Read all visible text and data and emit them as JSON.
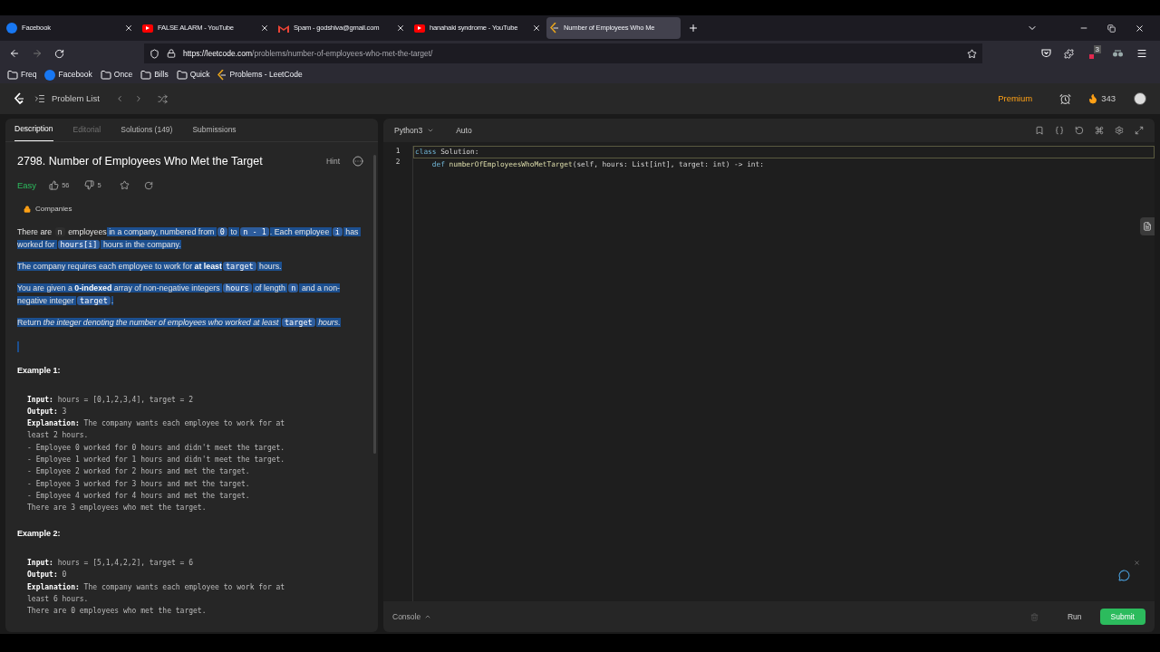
{
  "browser_tabs": [
    {
      "title": "Facebook",
      "kind": "facebook",
      "selected": false
    },
    {
      "title": "FALSE ALARM - YouTube",
      "kind": "youtube",
      "selected": false
    },
    {
      "title": "Spam - godshiva@gmail.com",
      "kind": "mail",
      "selected": false
    },
    {
      "title": "hanahaki syndrome - YouTube",
      "kind": "youtube",
      "selected": false
    },
    {
      "title": "Number of Employees Who Me",
      "kind": "leetcode",
      "selected": true
    }
  ],
  "address_bar": {
    "url_host": "https://leetcode.com",
    "url_path": "/problems/number-of-employees-who-met-the-target/"
  },
  "extension_badge": "3",
  "bookmarks": [
    {
      "label": "Freq",
      "kind": "folder"
    },
    {
      "label": "Facebook",
      "kind": "facebook"
    },
    {
      "label": "Once",
      "kind": "folder"
    },
    {
      "label": "Bills",
      "kind": "folder"
    },
    {
      "label": "Quick",
      "kind": "folder"
    },
    {
      "label": "Problems - LeetCode",
      "kind": "leetcode"
    }
  ],
  "site_header": {
    "problem_list": "Problem List",
    "premium": "Premium",
    "streak": "343"
  },
  "panel_tabs": [
    {
      "label": "Description",
      "selected": true,
      "disabled": false
    },
    {
      "label": "Editorial",
      "selected": false,
      "disabled": true
    },
    {
      "label": "Solutions (149)",
      "selected": false,
      "disabled": false
    },
    {
      "label": "Submissions",
      "selected": false,
      "disabled": false
    }
  ],
  "problem": {
    "title": "2798. Number of Employees Who Met the Target",
    "hint": "Hint",
    "difficulty": "Easy",
    "likes": "56",
    "dislikes": "5",
    "companies": "Companies",
    "paragraphs": [
      [
        {
          "text": "There are ",
          "kind": "text",
          "highlighted": false
        },
        {
          "text": "n",
          "kind": "code",
          "highlighted": false
        },
        {
          "text": " employees",
          "kind": "text",
          "highlighted": false
        },
        {
          "text": " in a company, numbered from ",
          "kind": "text",
          "highlighted": true
        },
        {
          "text": "0",
          "kind": "code",
          "highlighted": true
        },
        {
          "text": " to ",
          "kind": "text",
          "highlighted": true
        },
        {
          "text": "n - 1",
          "kind": "code",
          "highlighted": true
        },
        {
          "text": ". Each employee ",
          "kind": "text",
          "highlighted": true
        },
        {
          "text": "i",
          "kind": "code",
          "highlighted": true
        },
        {
          "text": " has worked for ",
          "kind": "text",
          "highlighted": true
        },
        {
          "text": "hours[i]",
          "kind": "code",
          "highlighted": true
        },
        {
          "text": " hours in the company.",
          "kind": "text",
          "highlighted": true
        }
      ],
      [
        {
          "text": "The company requires each employee to work for ",
          "kind": "text",
          "highlighted": true
        },
        {
          "text": "at least",
          "kind": "bold",
          "highlighted": true
        },
        {
          "text": "target",
          "kind": "code",
          "highlighted": true
        },
        {
          "text": " hours.",
          "kind": "text",
          "highlighted": true
        }
      ],
      [
        {
          "text": "You are given a ",
          "kind": "text",
          "highlighted": true
        },
        {
          "text": "0-indexed",
          "kind": "bold",
          "highlighted": true
        },
        {
          "text": " array of non-negative integers ",
          "kind": "text",
          "highlighted": true
        },
        {
          "text": "hours",
          "kind": "code",
          "highlighted": true
        },
        {
          "text": " of length ",
          "kind": "text",
          "highlighted": true
        },
        {
          "text": "n",
          "kind": "code",
          "highlighted": true
        },
        {
          "text": " and a non-negative integer ",
          "kind": "text",
          "highlighted": true
        },
        {
          "text": "target",
          "kind": "code",
          "highlighted": true
        },
        {
          "text": ".",
          "kind": "text",
          "highlighted": true
        }
      ],
      [
        {
          "text": "Return ",
          "kind": "text",
          "highlighted": true
        },
        {
          "text": "the integer denoting the number of employees who worked at least ",
          "kind": "italic",
          "highlighted": true
        },
        {
          "text": "target",
          "kind": "code",
          "highlighted": true
        },
        {
          "text": " hours.",
          "kind": "italic",
          "highlighted": true
        }
      ]
    ],
    "examples": [
      {
        "title": "Example 1:",
        "lines": [
          {
            "label": "Input:",
            "text": " hours = [0,1,2,3,4], target = 2"
          },
          {
            "label": "Output:",
            "text": " 3"
          },
          {
            "label": "Explanation:",
            "text": " The company wants each employee to work for at least 2 hours."
          },
          {
            "text": "- Employee 0 worked for 0 hours and didn't meet the target."
          },
          {
            "text": "- Employee 1 worked for 1 hours and didn't meet the target."
          },
          {
            "text": "- Employee 2 worked for 2 hours and met the target."
          },
          {
            "text": "- Employee 3 worked for 3 hours and met the target."
          },
          {
            "text": "- Employee 4 worked for 4 hours and met the target."
          },
          {
            "text": "There are 3 employees who met the target."
          }
        ]
      },
      {
        "title": "Example 2:",
        "lines": [
          {
            "label": "Input:",
            "text": " hours = [5,1,4,2,2], target = 6"
          },
          {
            "label": "Output:",
            "text": " 0"
          },
          {
            "label": "Explanation:",
            "text": " The company wants each employee to work for at least 6 hours."
          },
          {
            "text": "There are 0 employees who met the target."
          }
        ]
      }
    ]
  },
  "editor": {
    "language": "Python3",
    "mode": "Auto",
    "lines": [
      {
        "number": "1",
        "tokens": [
          {
            "text": "class",
            "kind": "keyword"
          },
          {
            "text": " Solution:",
            "kind": "plain"
          }
        ]
      },
      {
        "number": "2",
        "tokens": [
          {
            "text": "    def",
            "kind": "keyword"
          },
          {
            "text": " numberOfEmployeesWhoMetTarget",
            "kind": "function"
          },
          {
            "text": "(self, hours: List[int], target: int) -> int:",
            "kind": "plain"
          }
        ]
      }
    ]
  },
  "footer": {
    "console": "Console",
    "run": "Run",
    "submit": "Submit"
  }
}
